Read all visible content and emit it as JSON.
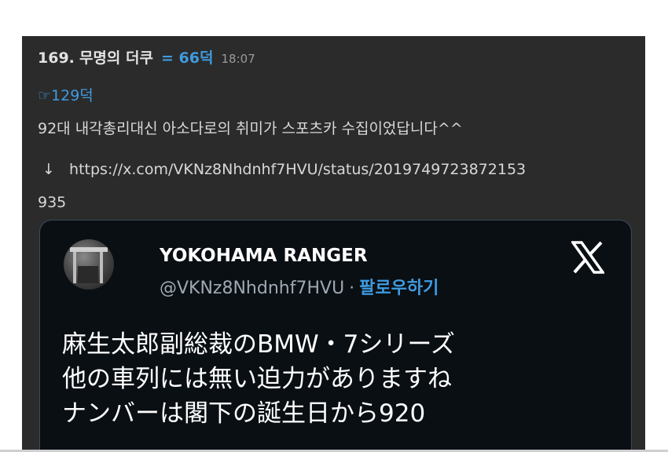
{
  "post": {
    "number": "169.",
    "author": "무명의 더쿠",
    "score": "= 66덕",
    "time": "18:07",
    "reply_ref": "☞129덕",
    "body_line1": "92대 내각총리대신 아소다로의 취미가 스포츠카 수집이었답니다^^",
    "arrow": "↓",
    "link_line1": "https://x.com/VKNz8Nhdnhf7HVU/status/2019749723872153",
    "link_line2": "935"
  },
  "tweet": {
    "display_name": "YOKOHAMA RANGER",
    "handle": "@VKNz8Nhdnhf7HVU",
    "separator": "·",
    "follow_label": "팔로우하기",
    "line1": "麻生太郎副総裁のBMW・7シリーズ",
    "line2": "他の車列には無い迫力がありますね",
    "line3": "ナンバーは閣下の誕生日から920"
  },
  "icons": {
    "x_logo": "x-logo-icon",
    "avatar": "avatar-image"
  },
  "colors": {
    "post_bg": "#2b2b2b",
    "accent": "#3f9be0",
    "card_bg": "#0a0f14",
    "card_border": "#3b4a5a"
  }
}
